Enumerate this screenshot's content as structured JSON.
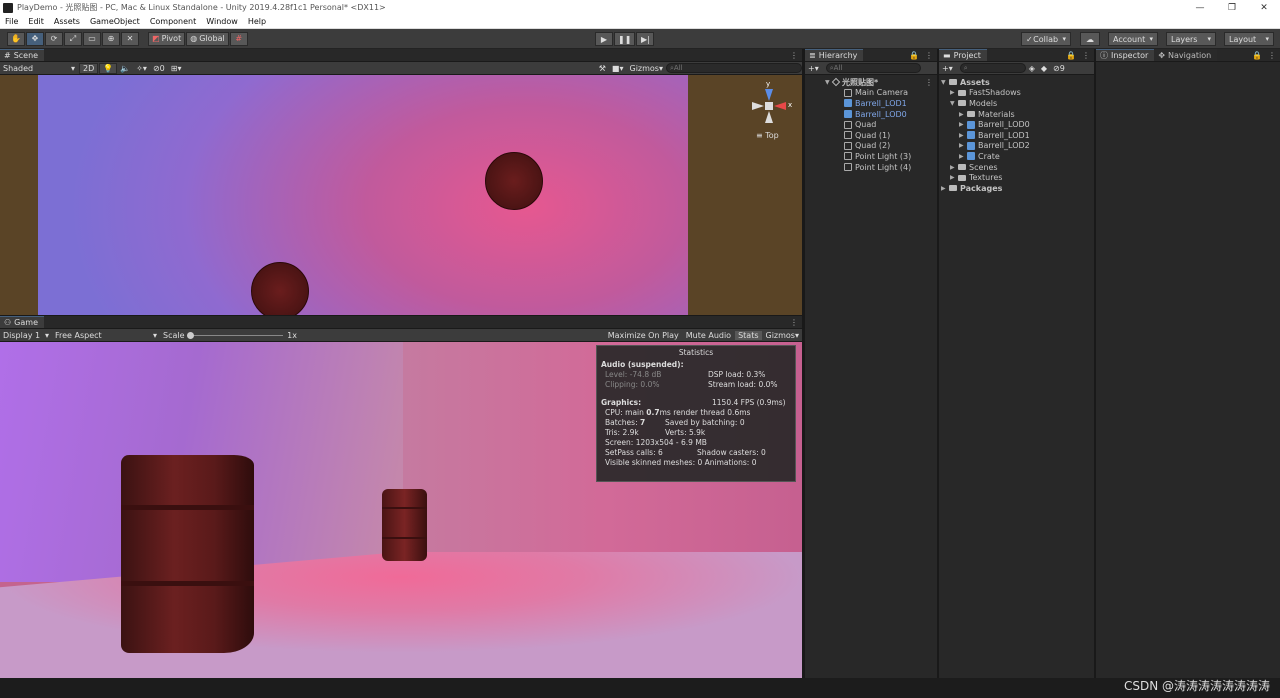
{
  "window": {
    "title": "PlayDemo - 光照贴图 - PC, Mac & Linux Standalone - Unity 2019.4.28f1c1 Personal* <DX11>",
    "controls": [
      "—",
      "❐",
      "✕"
    ]
  },
  "menu": [
    "File",
    "Edit",
    "Assets",
    "GameObject",
    "Component",
    "Window",
    "Help"
  ],
  "toolbar": {
    "pivot": "Pivot",
    "global": "Global",
    "collab": "Collab",
    "account": "Account",
    "layers": "Layers",
    "layout": "Layout"
  },
  "scene": {
    "tab": "Scene",
    "shading": "Shaded",
    "mode2d": "2D",
    "hidden_count": "0",
    "gizmos": "Gizmos",
    "search_placeholder": "All",
    "gizmo_axes": {
      "y": "y",
      "x": "x",
      "view": "Top"
    }
  },
  "game": {
    "tab": "Game",
    "display": "Display 1",
    "aspect": "Free Aspect",
    "scale_label": "Scale",
    "scale_value": "1x",
    "maximize": "Maximize On Play",
    "mute": "Mute Audio",
    "stats": "Stats",
    "gizmos": "Gizmos"
  },
  "statistics": {
    "title": "Statistics",
    "audio_header": "Audio (suspended):",
    "level": "Level: -74.8 dB",
    "clipping": "Clipping: 0.0%",
    "dsp": "DSP load: 0.3%",
    "stream": "Stream load: 0.0%",
    "graphics_header": "Graphics:",
    "fps": "1150.4 FPS (0.9ms)",
    "cpu_label": "CPU: main",
    "cpu_main": "0.7",
    "cpu_rest": "ms  render thread 0.6ms",
    "batches_label": "Batches:",
    "batches": "7",
    "saved": "Saved by batching: 0",
    "tris": "Tris: 2.9k",
    "verts": "Verts: 5.9k",
    "screen": "Screen: 1203x504 - 6.9 MB",
    "setpass": "SetPass calls: 6",
    "shadow": "Shadow casters: 0",
    "skinned": "Visible skinned meshes: 0  Animations: 0"
  },
  "hierarchy": {
    "tab": "Hierarchy",
    "search_placeholder": "All",
    "scene_name": "光照贴图*",
    "items": [
      {
        "label": "Main Camera",
        "type": "go"
      },
      {
        "label": "Barrell_LOD1",
        "type": "prefab"
      },
      {
        "label": "Barrell_LOD0",
        "type": "prefab"
      },
      {
        "label": "Quad",
        "type": "go"
      },
      {
        "label": "Quad (1)",
        "type": "go"
      },
      {
        "label": "Quad (2)",
        "type": "go"
      },
      {
        "label": "Point Light (3)",
        "type": "go"
      },
      {
        "label": "Point Light (4)",
        "type": "go"
      }
    ]
  },
  "project": {
    "tab": "Project",
    "hidden_count": "9",
    "tree": [
      {
        "label": "Assets",
        "depth": 0,
        "arrow": "▼",
        "bold": true,
        "icon": "folder"
      },
      {
        "label": "FastShadows",
        "depth": 1,
        "arrow": "▶",
        "icon": "folder"
      },
      {
        "label": "Models",
        "depth": 1,
        "arrow": "▼",
        "icon": "folder"
      },
      {
        "label": "Materials",
        "depth": 2,
        "arrow": "▶",
        "icon": "folder"
      },
      {
        "label": "Barrell_LOD0",
        "depth": 2,
        "arrow": "▶",
        "icon": "prefab"
      },
      {
        "label": "Barrell_LOD1",
        "depth": 2,
        "arrow": "▶",
        "icon": "prefab"
      },
      {
        "label": "Barrell_LOD2",
        "depth": 2,
        "arrow": "▶",
        "icon": "prefab"
      },
      {
        "label": "Crate",
        "depth": 2,
        "arrow": "▶",
        "icon": "prefab"
      },
      {
        "label": "Scenes",
        "depth": 1,
        "arrow": "▶",
        "icon": "folder"
      },
      {
        "label": "Textures",
        "depth": 1,
        "arrow": "▶",
        "icon": "folder"
      },
      {
        "label": "Packages",
        "depth": 0,
        "arrow": "▶",
        "bold": true,
        "icon": "folder"
      }
    ]
  },
  "inspector": {
    "tab": "Inspector",
    "nav_tab": "Navigation"
  },
  "watermark": "CSDN @涛涛涛涛涛涛涛涛"
}
